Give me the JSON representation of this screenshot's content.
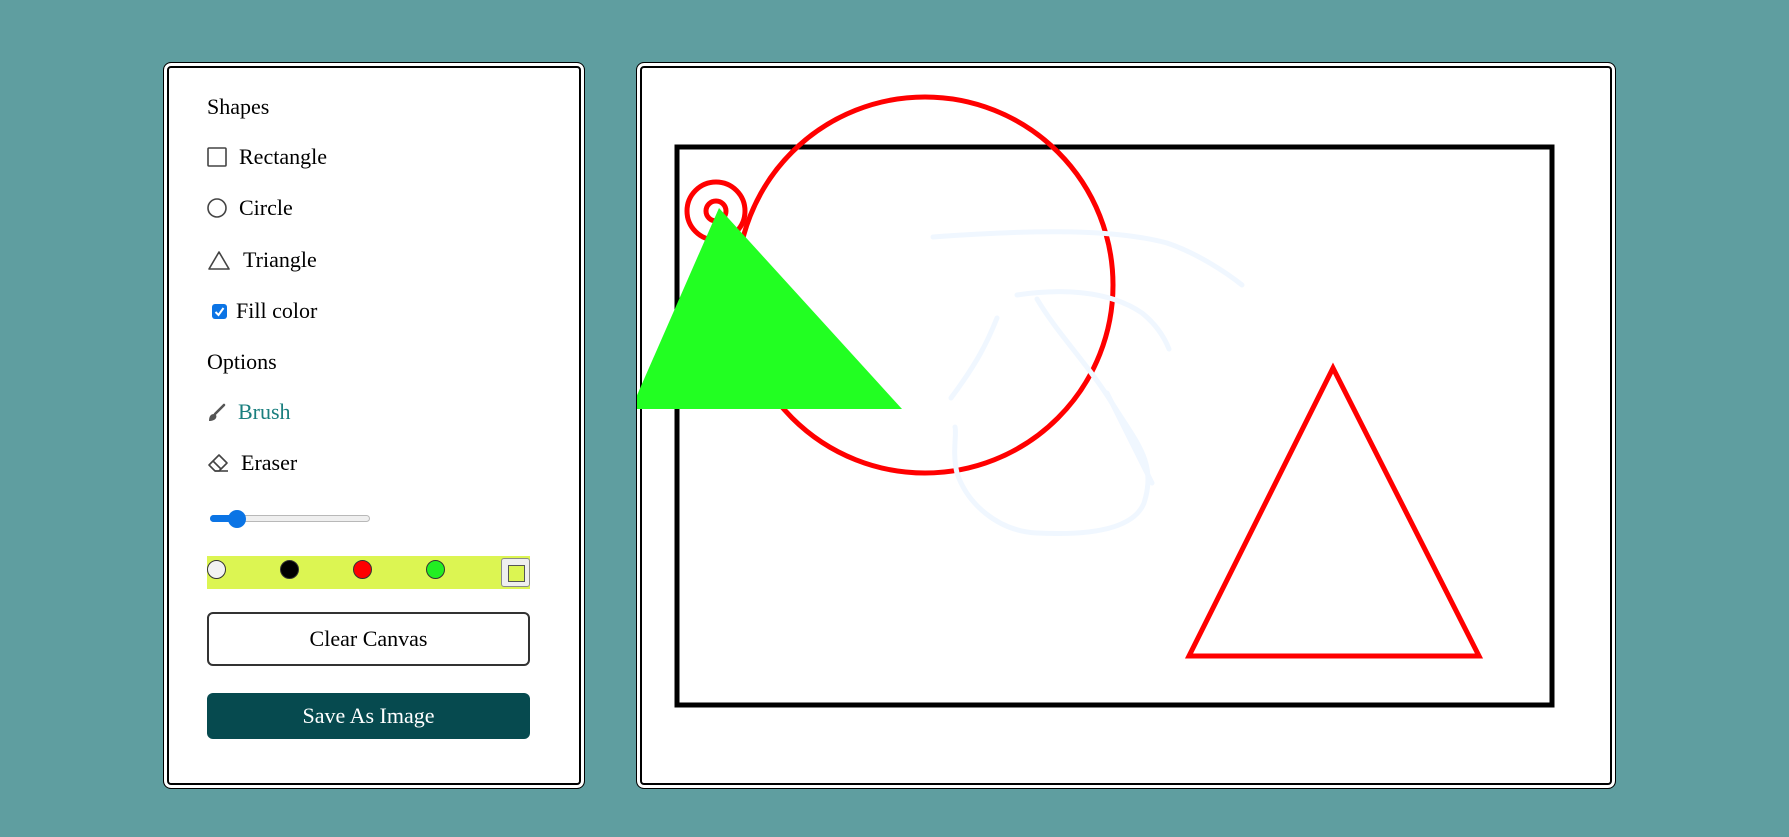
{
  "tools": {
    "shapes_title": "Shapes",
    "shapes": [
      {
        "label": "Rectangle",
        "icon": "square-icon"
      },
      {
        "label": "Circle",
        "icon": "circle-icon"
      },
      {
        "label": "Triangle",
        "icon": "triangle-icon"
      }
    ],
    "fill_color": {
      "label": "Fill color",
      "checked": true
    },
    "options_title": "Options",
    "options": [
      {
        "label": "Brush",
        "icon": "brush-icon",
        "active": true
      },
      {
        "label": "Eraser",
        "icon": "eraser-icon",
        "active": false
      }
    ],
    "brush_size": {
      "value": 0.17
    },
    "colors": [
      "#f2f2f2",
      "#000000",
      "#ff0000",
      "#22ee22"
    ],
    "custom_color": "#dcf552",
    "clear_label": "Clear Canvas",
    "save_label": "Save As Image"
  },
  "theme": {
    "page_bg": "#5f9ea0",
    "accent": "#1a7f7f",
    "save_bg": "#064a4f",
    "palette_bg": "#dcf552",
    "checkbox": "#0b74e5"
  },
  "canvas": {
    "drawing": {
      "rectangle": {
        "stroke": "#000000"
      },
      "big_circle": {
        "stroke": "#ff0000"
      },
      "small_circle": {
        "stroke": "#ff0000"
      },
      "filled_triangle": {
        "fill": "#22ff22"
      },
      "outline_triangle": {
        "stroke": "#ff0000"
      },
      "eraser_strokes": {
        "color": "#f0f7ff"
      }
    }
  }
}
